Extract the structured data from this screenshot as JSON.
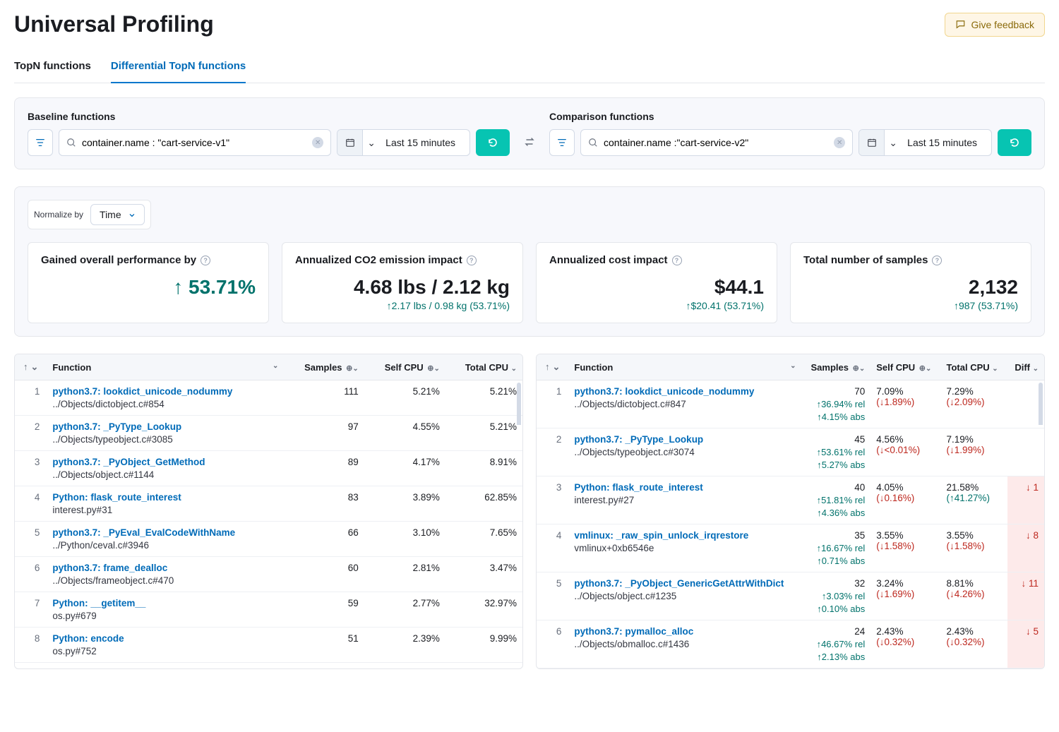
{
  "header": {
    "title": "Universal Profiling",
    "feedback": "Give feedback"
  },
  "tabs": {
    "t0": "TopN functions",
    "t1": "Differential TopN functions"
  },
  "baseline": {
    "label": "Baseline functions",
    "query": "container.name : \"cart-service-v1\"",
    "daterange": "Last 15 minutes"
  },
  "comparison": {
    "label": "Comparison functions",
    "query": "container.name :\"cart-service-v2\"",
    "daterange": "Last 15 minutes"
  },
  "normalize": {
    "label": "Normalize by",
    "value": "Time"
  },
  "stats": {
    "s0": {
      "title": "Gained overall performance by",
      "value": "53.71%",
      "sub": ""
    },
    "s1": {
      "title": "Annualized CO2 emission impact",
      "value": "4.68 lbs / 2.12 kg",
      "sub": "2.17 lbs / 0.98 kg (53.71%)"
    },
    "s2": {
      "title": "Annualized cost impact",
      "value": "$44.1",
      "sub": "$20.41 (53.71%)"
    },
    "s3": {
      "title": "Total number of samples",
      "value": "2,132",
      "sub": "987 (53.71%)"
    }
  },
  "table_hdr": {
    "fn": "Function",
    "samples": "Samples",
    "self": "Self CPU",
    "total": "Total CPU",
    "diff": "Diff"
  },
  "baseline_rows": [
    {
      "rank": "1",
      "fn": "python3.7: lookdict_unicode_nodummy",
      "loc": "../Objects/dictobject.c#854",
      "samples": "111",
      "self": "5.21%",
      "total": "5.21%"
    },
    {
      "rank": "2",
      "fn": "python3.7: _PyType_Lookup",
      "loc": "../Objects/typeobject.c#3085",
      "samples": "97",
      "self": "4.55%",
      "total": "5.21%"
    },
    {
      "rank": "3",
      "fn": "python3.7: _PyObject_GetMethod",
      "loc": "../Objects/object.c#1144",
      "samples": "89",
      "self": "4.17%",
      "total": "8.91%"
    },
    {
      "rank": "4",
      "fn": "Python: flask_route_interest",
      "loc": "interest.py#31",
      "samples": "83",
      "self": "3.89%",
      "total": "62.85%"
    },
    {
      "rank": "5",
      "fn": "python3.7: _PyEval_EvalCodeWithName",
      "loc": "../Python/ceval.c#3946",
      "samples": "66",
      "self": "3.10%",
      "total": "7.65%"
    },
    {
      "rank": "6",
      "fn": "python3.7: frame_dealloc",
      "loc": "../Objects/frameobject.c#470",
      "samples": "60",
      "self": "2.81%",
      "total": "3.47%"
    },
    {
      "rank": "7",
      "fn": "Python: __getitem__",
      "loc": "os.py#679",
      "samples": "59",
      "self": "2.77%",
      "total": "32.97%"
    },
    {
      "rank": "8",
      "fn": "Python: encode",
      "loc": "os.py#752",
      "samples": "51",
      "self": "2.39%",
      "total": "9.99%"
    }
  ],
  "comp_rows": [
    {
      "rank": "1",
      "fn": "python3.7: lookdict_unicode_nodummy",
      "loc": "../Objects/dictobject.c#847",
      "samples": "70",
      "srel": "36.94% rel",
      "sabs": "4.15% abs",
      "self": "7.09%",
      "selfd": "1.89%",
      "selfd_dir": "down",
      "total": "7.29%",
      "totald": "2.09%",
      "totald_dir": "down",
      "diff": "",
      "diff_dir": ""
    },
    {
      "rank": "2",
      "fn": "python3.7: _PyType_Lookup",
      "loc": "../Objects/typeobject.c#3074",
      "samples": "45",
      "srel": "53.61% rel",
      "sabs": "5.27% abs",
      "self": "4.56%",
      "selfd": "<0.01%",
      "selfd_dir": "down",
      "total": "7.19%",
      "totald": "1.99%",
      "totald_dir": "down",
      "diff": "",
      "diff_dir": ""
    },
    {
      "rank": "3",
      "fn": "Python: flask_route_interest",
      "loc": "interest.py#27",
      "samples": "40",
      "srel": "51.81% rel",
      "sabs": "4.36% abs",
      "self": "4.05%",
      "selfd": "0.16%",
      "selfd_dir": "down",
      "total": "21.58%",
      "totald": "41.27%",
      "totald_dir": "up",
      "diff": "1",
      "diff_dir": "down"
    },
    {
      "rank": "4",
      "fn": "vmlinux: _raw_spin_unlock_irqrestore",
      "loc": "vmlinux+0xb6546e",
      "samples": "35",
      "srel": "16.67% rel",
      "sabs": "0.71% abs",
      "self": "3.55%",
      "selfd": "1.58%",
      "selfd_dir": "down",
      "total": "3.55%",
      "totald": "1.58%",
      "totald_dir": "down",
      "diff": "8",
      "diff_dir": "down"
    },
    {
      "rank": "5",
      "fn": "python3.7: _PyObject_GenericGetAttrWithDict",
      "loc": "../Objects/object.c#1235",
      "samples": "32",
      "srel": "3.03% rel",
      "sabs": "0.10% abs",
      "self": "3.24%",
      "selfd": "1.69%",
      "selfd_dir": "down",
      "total": "8.81%",
      "totald": "4.26%",
      "totald_dir": "down",
      "diff": "11",
      "diff_dir": "down"
    },
    {
      "rank": "6",
      "fn": "python3.7: pymalloc_alloc",
      "loc": "../Objects/obmalloc.c#1436",
      "samples": "24",
      "srel": "46.67% rel",
      "sabs": "2.13% abs",
      "self": "2.43%",
      "selfd": "0.32%",
      "selfd_dir": "down",
      "total": "2.43%",
      "totald": "0.32%",
      "totald_dir": "down",
      "diff": "5",
      "diff_dir": "down"
    }
  ]
}
